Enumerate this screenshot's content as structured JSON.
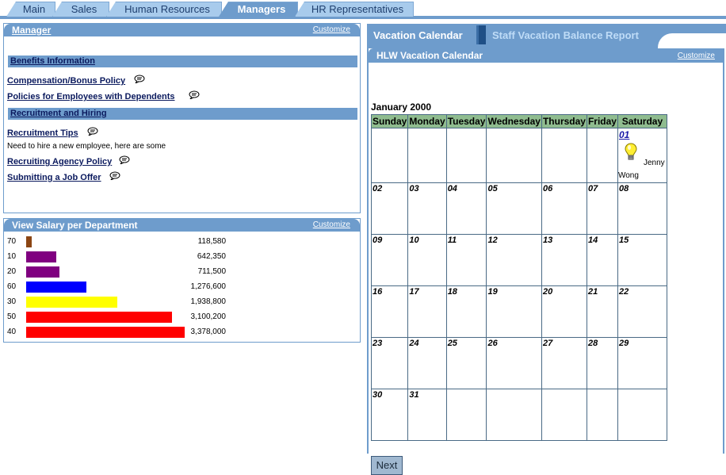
{
  "tabs": [
    {
      "label": "Main",
      "active": false
    },
    {
      "label": "Sales",
      "active": false
    },
    {
      "label": "Human Resources",
      "active": false
    },
    {
      "label": "Managers",
      "active": true
    },
    {
      "label": "HR Representatives",
      "active": false
    }
  ],
  "manager_panel": {
    "title": "Manager",
    "customize": "Customize",
    "sections": [
      {
        "label": "Benefits Information",
        "items": [
          "Compensation/Bonus Policy",
          "Policies for Employees with Dependents"
        ]
      },
      {
        "label": "Recruitment and Hiring",
        "items": [
          "Recruitment Tips",
          "Recruiting Agency Policy",
          "Submitting a Job Offer"
        ]
      }
    ],
    "recruitment_note": "Need to hire a new employee, here are some"
  },
  "salary_panel": {
    "title": "View Salary per Department",
    "customize": "Customize",
    "rows": [
      {
        "dept": "70",
        "value": 118580,
        "display": "118,580",
        "color": "#8b4513"
      },
      {
        "dept": "10",
        "value": 642350,
        "display": "642,350",
        "color": "#800080"
      },
      {
        "dept": "20",
        "value": 711500,
        "display": "711,500",
        "color": "#800080"
      },
      {
        "dept": "60",
        "value": 1276600,
        "display": "1,276,600",
        "color": "#0000ff"
      },
      {
        "dept": "30",
        "value": 1938800,
        "display": "1,938,800",
        "color": "#ffff00"
      },
      {
        "dept": "50",
        "value": 3100200,
        "display": "3,100,200",
        "color": "#ff0000"
      },
      {
        "dept": "40",
        "value": 3378000,
        "display": "3,378,000",
        "color": "#ff0000"
      }
    ]
  },
  "right_tabs": {
    "active": "Vacation Calendar",
    "inactive": "Staff Vacation Balance Report"
  },
  "calendar": {
    "panel_title": "HLW Vacation Calendar",
    "customize": "Customize",
    "month": "January 2000",
    "weekdays": [
      "Sunday",
      "Monday",
      "Tuesday",
      "Wednesday",
      "Thursday",
      "Friday",
      "Saturday"
    ],
    "weeks": [
      [
        "",
        "",
        "",
        "",
        "",
        "",
        "01"
      ],
      [
        "02",
        "03",
        "04",
        "05",
        "06",
        "07",
        "08"
      ],
      [
        "09",
        "10",
        "11",
        "12",
        "13",
        "14",
        "15"
      ],
      [
        "16",
        "17",
        "18",
        "19",
        "20",
        "21",
        "22"
      ],
      [
        "23",
        "24",
        "25",
        "26",
        "27",
        "28",
        "29"
      ],
      [
        "30",
        "31",
        "",
        "",
        "",
        "",
        ""
      ]
    ],
    "event": {
      "first": "Jenny",
      "last": "Wong"
    },
    "next_label": "Next"
  },
  "colors": {
    "accent": "#6e9ccc",
    "header_green": "#8fbc8f",
    "link": "#0b1a5e"
  }
}
